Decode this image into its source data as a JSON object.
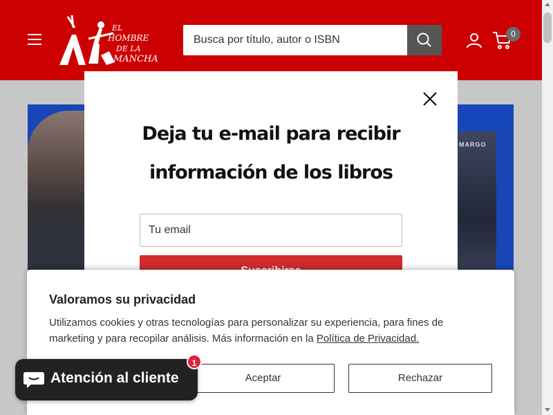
{
  "header": {
    "logo": {
      "line1": "EL",
      "line2": "HOMBRE",
      "line3": "DE LA",
      "line4": "MANCHA"
    },
    "search": {
      "placeholder": "Busca por título, autor o ISBN"
    },
    "cart": {
      "count": "0"
    },
    "icons": {
      "menu": "hamburger-icon",
      "search": "search-icon",
      "account": "user-icon",
      "cart": "cart-icon"
    }
  },
  "banner": {
    "book_title": "MARGO"
  },
  "newsletter_modal": {
    "title_line1": "Deja tu e-mail para recibir",
    "title_line2": "información de los libros",
    "email_placeholder": "Tu email",
    "submit_label": "Suscribirse",
    "close_icon": "close-icon"
  },
  "cookie_banner": {
    "title": "Valoramos su privacidad",
    "text": "Utilizamos cookies y otras tecnologías para personalizar su experiencia, para fines de marketing y para recopilar análisis. Más información en la ",
    "link_text": "Política de Privacidad.",
    "accept_label": "Aceptar",
    "reject_label": "Rechazar"
  },
  "chat_widget": {
    "label": "Atención al cliente",
    "badge": "1",
    "icon": "chat-bubble-icon"
  },
  "colors": {
    "header_bg": "#cc0000",
    "submit_bg": "#d12b2b",
    "chat_bg": "#222222",
    "badge_bg": "#e0223a"
  }
}
